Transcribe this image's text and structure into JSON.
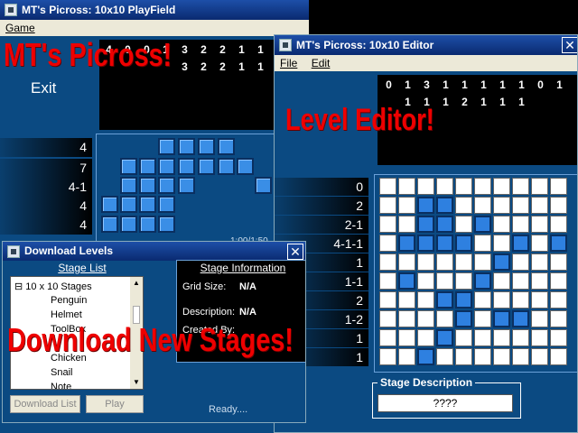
{
  "playfield": {
    "title": "MT's Picross: 10x10 PlayField",
    "menu": [
      "Game"
    ],
    "exit_label": "Exit",
    "col_clues_top": [
      "4",
      "0",
      "0",
      "1",
      "3",
      "2",
      "2",
      "1",
      "1"
    ],
    "col_clues_bottom": [
      "",
      "",
      "",
      "",
      "3",
      "2",
      "2",
      "1",
      "1"
    ],
    "row_clues": [
      "4",
      "7",
      "4-1",
      "4",
      "4"
    ],
    "status_partial": "1:00/1:50"
  },
  "editor": {
    "title": "MT's Picross: 10x10 Editor",
    "menu": [
      "File",
      "Edit"
    ],
    "col_clues_top": [
      "0",
      "1",
      "3",
      "1",
      "1",
      "1",
      "1",
      "1",
      "0",
      "1"
    ],
    "col_clues_bottom": [
      "",
      "1",
      "1",
      "1",
      "2",
      "1",
      "1",
      "1",
      "",
      ""
    ],
    "row_clues": [
      "0",
      "2",
      "2-1",
      "4-1-1",
      "1",
      "1-1",
      "2",
      "1-2",
      "1",
      "1"
    ],
    "grid": [
      [
        0,
        0,
        0,
        0,
        0,
        0,
        0,
        0,
        0,
        0
      ],
      [
        0,
        0,
        1,
        1,
        0,
        0,
        0,
        0,
        0,
        0
      ],
      [
        0,
        0,
        1,
        1,
        0,
        1,
        0,
        0,
        0,
        0
      ],
      [
        0,
        1,
        1,
        1,
        1,
        0,
        0,
        1,
        0,
        1
      ],
      [
        0,
        0,
        0,
        0,
        0,
        0,
        1,
        0,
        0,
        0
      ],
      [
        0,
        1,
        0,
        0,
        0,
        1,
        0,
        0,
        0,
        0
      ],
      [
        0,
        0,
        0,
        1,
        1,
        0,
        0,
        0,
        0,
        0
      ],
      [
        0,
        0,
        0,
        0,
        1,
        0,
        1,
        1,
        0,
        0
      ],
      [
        0,
        0,
        0,
        1,
        0,
        0,
        0,
        0,
        0,
        0
      ],
      [
        0,
        0,
        1,
        0,
        0,
        0,
        0,
        0,
        0,
        0
      ]
    ],
    "stage_description_label": "Stage Description",
    "stage_description_value": "????"
  },
  "download": {
    "title": "Download Levels",
    "stage_list_label": "Stage List",
    "tree_root": "10 x 10 Stages",
    "tree_items": [
      "Penguin",
      "Helmet",
      "ToolBox",
      "",
      "Chicken",
      "Snail",
      "Note"
    ],
    "stage_info_label": "Stage Information",
    "grid_size_label": "Grid Size:",
    "grid_size_value": "N/A",
    "description_label": "Description:",
    "description_value": "N/A",
    "created_by_label": "Created By:",
    "download_button": "Download List",
    "play_button": "Play",
    "status": "Ready...."
  },
  "overlays": {
    "title": "MT's Picross!",
    "editor": "Level Editor!",
    "download": "Download New Stages!"
  }
}
